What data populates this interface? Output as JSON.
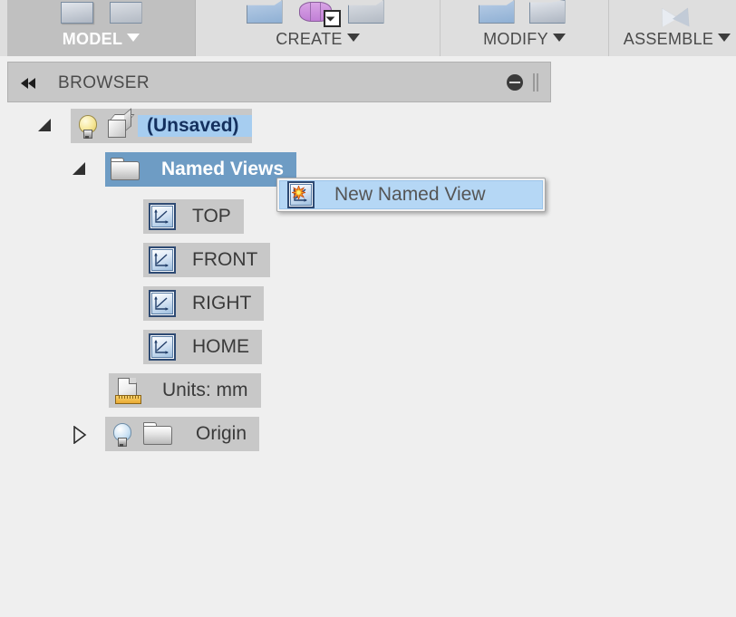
{
  "app": {
    "ribbon": {
      "panels": [
        {
          "label": "MODEL",
          "active": true,
          "caret": "chevron-down-icon",
          "icons": [
            "sketch-solid-icon",
            "model-workspace-icon",
            "sketch-edit-icon"
          ]
        },
        {
          "label": "CREATE",
          "active": false,
          "caret": "chevron-down-icon",
          "icons": [
            "extrude-icon",
            "revolve-icon",
            "sweep-icon"
          ]
        },
        {
          "label": "MODIFY",
          "active": false,
          "caret": "chevron-down-icon",
          "icons": [
            "press-pull-icon",
            "fillet-icon"
          ]
        },
        {
          "label": "ASSEMBLE",
          "active": false,
          "caret": "chevron-down-icon",
          "icons": [
            "joint-icon",
            "as-built-joint-icon"
          ]
        }
      ]
    },
    "browser": {
      "title": "BROWSER",
      "collapse_icon": "double-chevron-left-icon",
      "minimize_icon": "minus-circle-icon",
      "grip_icon": "grip-handle-icon"
    },
    "tree": {
      "nodes": [
        {
          "label": "(Unsaved)",
          "indent": 0,
          "twisty": "expanded",
          "icons": [
            "lightbulb-on-icon",
            "cube-icon"
          ],
          "selection": "light"
        },
        {
          "label": "Named Views",
          "indent": 1,
          "twisty": "expanded",
          "icons": [
            "folder-icon"
          ],
          "selection": "strong"
        },
        {
          "label": "TOP",
          "indent": 2,
          "twisty": "none",
          "icons": [
            "named-view-icon"
          ],
          "selection": "none"
        },
        {
          "label": "FRONT",
          "indent": 2,
          "twisty": "none",
          "icons": [
            "named-view-icon"
          ],
          "selection": "none"
        },
        {
          "label": "RIGHT",
          "indent": 2,
          "twisty": "none",
          "icons": [
            "named-view-icon"
          ],
          "selection": "none"
        },
        {
          "label": "HOME",
          "indent": 2,
          "twisty": "none",
          "icons": [
            "named-view-icon"
          ],
          "selection": "none"
        },
        {
          "label": "Units: mm",
          "indent": 1,
          "twisty": "none",
          "icons": [
            "units-document-icon"
          ],
          "selection": "none"
        },
        {
          "label": "Origin",
          "indent": 1,
          "twisty": "collapsed",
          "icons": [
            "lightbulb-off-icon",
            "folder-icon"
          ],
          "selection": "none"
        }
      ]
    },
    "context_menu": {
      "items": [
        {
          "label": "New Named View",
          "icon": "new-named-view-icon",
          "highlighted": true
        }
      ]
    },
    "colors": {
      "ribbon_bg": "#dedede",
      "ribbon_active": "#c0c0c0",
      "panel_bg": "#efefef",
      "header_bg": "#c7c7c7",
      "row_bg": "#c8c8c8",
      "selection_light": "#a6cdf0",
      "selection_light_text": "#14305e",
      "selection_strong": "#6e9cc4",
      "menu_highlight": "#b5d7f5",
      "bulb_on": "#f6e79a",
      "bulb_off": "#9dc3e0",
      "ruler_accent": "#e8a933",
      "burst_accent": "#f5a623"
    }
  }
}
